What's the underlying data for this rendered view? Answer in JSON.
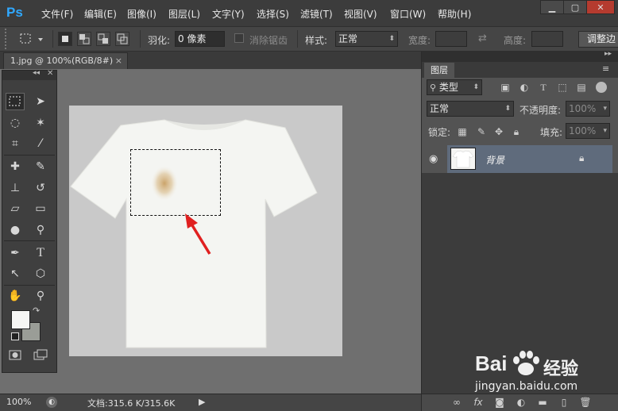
{
  "app": {
    "logo": "Ps"
  },
  "menu": [
    "文件(F)",
    "编辑(E)",
    "图像(I)",
    "图层(L)",
    "文字(Y)",
    "选择(S)",
    "滤镜(T)",
    "视图(V)",
    "窗口(W)",
    "帮助(H)"
  ],
  "window_controls": {
    "minimize": "▁",
    "maximize": "▢",
    "close": "✕"
  },
  "options": {
    "feather_label": "羽化:",
    "feather_value": "0 像素",
    "antialias_label": "消除锯齿",
    "style_label": "样式:",
    "style_value": "正常",
    "width_label": "宽度:",
    "height_label": "高度:",
    "refine_button": "调整边"
  },
  "document": {
    "tab_title": "1.jpg @ 100%(RGB/8#)",
    "close": "×"
  },
  "status": {
    "zoom": "100%",
    "doc_info": "文档:315.6 K/315.6K"
  },
  "layers_panel": {
    "tab": "图层",
    "kind_label": "类型",
    "blend_mode": "正常",
    "opacity_label": "不透明度:",
    "opacity_value": "100%",
    "lock_label": "锁定:",
    "fill_label": "填充:",
    "fill_value": "100%",
    "layers": [
      {
        "name": "背景"
      }
    ]
  },
  "watermark": {
    "brand": "Bai",
    "brand2": "经验",
    "url": "jingyan.baidu.com"
  },
  "colors": {
    "selection_arrow": "#e02020",
    "accent": "#30a8ff"
  }
}
